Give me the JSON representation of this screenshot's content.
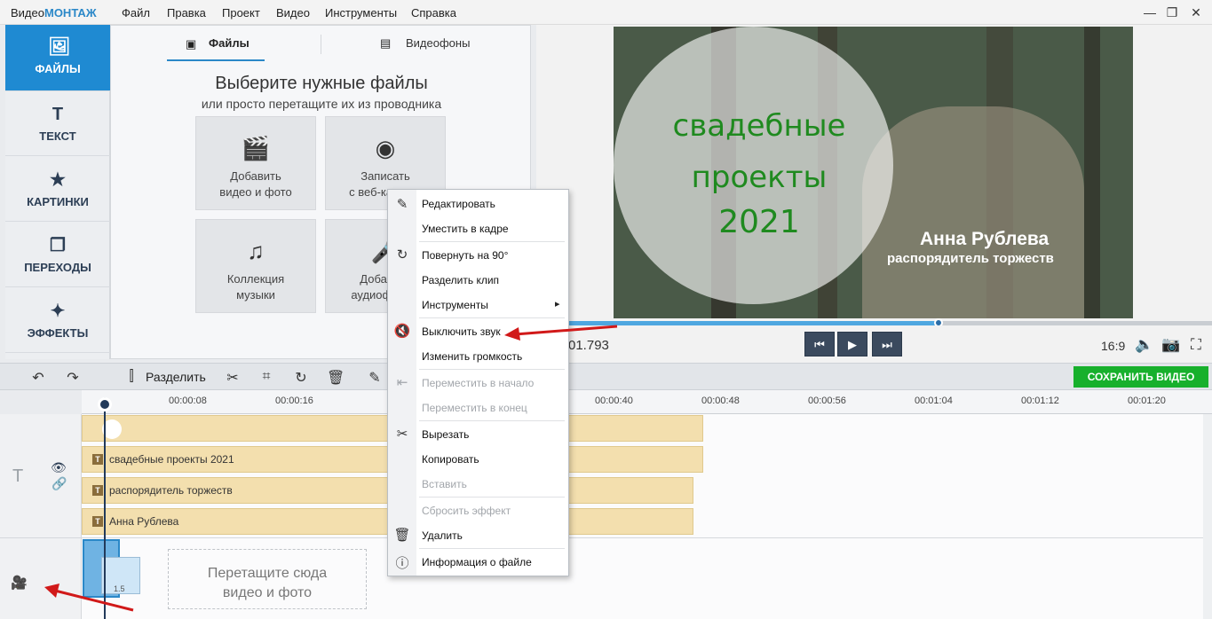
{
  "app": {
    "logo_prefix": "Видео",
    "logo_brand": "МОНТАЖ"
  },
  "menu": [
    "Файл",
    "Правка",
    "Проект",
    "Видео",
    "Инструменты",
    "Справка"
  ],
  "window_controls": {
    "minimize": "—",
    "maximize": "❐",
    "close": "✕"
  },
  "sidebar": {
    "items": [
      {
        "label": "ФАЙЛЫ",
        "icon": "image-icon",
        "glyph": "🖼",
        "active": true
      },
      {
        "label": "ТЕКСТ",
        "icon": "text-icon",
        "glyph": "T"
      },
      {
        "label": "КАРТИНКИ",
        "icon": "star-icon",
        "glyph": "★"
      },
      {
        "label": "ПЕРЕХОДЫ",
        "icon": "transitions-icon",
        "glyph": "❐"
      },
      {
        "label": "ЭФФЕКТЫ",
        "icon": "magic-wand-icon",
        "glyph": "✦"
      }
    ]
  },
  "files_panel": {
    "tabs": {
      "files": "Файлы",
      "backgrounds": "Видеофоны"
    },
    "title": "Выберите нужные файлы",
    "subtitle": "или просто перетащите их из проводника",
    "tiles": {
      "add_media": {
        "line1": "Добавить",
        "line2": "видео и фото"
      },
      "webcam": {
        "line1": "Записать",
        "line2": "с веб-камеры"
      },
      "music": {
        "line1": "Коллекция",
        "line2": "музыки"
      },
      "audio": {
        "line1": "Добавить",
        "line2": "аудиофайлы"
      }
    }
  },
  "preview": {
    "title_line1": "свадебные",
    "title_line2": "проекты",
    "title_line3": "2021",
    "name": "Анна Рублева",
    "role": "распорядитель торжеств",
    "timecode": "01.793",
    "progress": 0.595,
    "aspect_ratio": "16:9",
    "buttons": {
      "prev": "⏮",
      "play": "▶",
      "next": "⏭"
    }
  },
  "toolbar": {
    "split_label": "Разделить",
    "save_label": "СОХРАНИТЬ ВИДЕО",
    "accent": "#17b02c"
  },
  "ruler": {
    "ticks": [
      "00:00:08",
      "00:00:16",
      "00:00:40",
      "00:00:48",
      "00:00:56",
      "00:01:04",
      "00:01:12",
      "00:01:20"
    ]
  },
  "timeline": {
    "text_clips": [
      "свадебные  проекты  2021",
      "распорядитель торжеств",
      "Анна Рублева"
    ],
    "video_clip_length": "1.5",
    "dropzone_line1": "Перетащите сюда",
    "dropzone_line2": "видео и фото"
  },
  "context_menu": {
    "items": [
      {
        "label": "Редактировать",
        "icon": "pencil-icon",
        "enabled": true
      },
      {
        "label": "Уместить в кадре",
        "enabled": true
      },
      {
        "label": "Повернуть на 90°",
        "icon": "rotate-icon",
        "enabled": true
      },
      {
        "label": "Разделить клип",
        "enabled": true
      },
      {
        "label": "Инструменты",
        "enabled": true,
        "submenu": true
      },
      {
        "label": "Выключить звук",
        "icon": "mute-icon",
        "enabled": true
      },
      {
        "label": "Изменить громкость",
        "enabled": true
      },
      {
        "label": "Переместить в начало",
        "icon": "move-start-icon",
        "enabled": false
      },
      {
        "label": "Переместить в конец",
        "enabled": false
      },
      {
        "label": "Вырезать",
        "icon": "scissors-icon",
        "enabled": true
      },
      {
        "label": "Копировать",
        "enabled": true
      },
      {
        "label": "Вставить",
        "enabled": false
      },
      {
        "label": "Сбросить эффект",
        "enabled": false
      },
      {
        "label": "Удалить",
        "icon": "trash-icon",
        "enabled": true
      },
      {
        "label": "Информация о файле",
        "icon": "info-icon",
        "enabled": true
      }
    ],
    "submenu_arrow": "▸"
  },
  "colors": {
    "primary": "#1f8ad2",
    "annotation_arrow": "#d11919",
    "text_clip": "#f3dfae"
  }
}
